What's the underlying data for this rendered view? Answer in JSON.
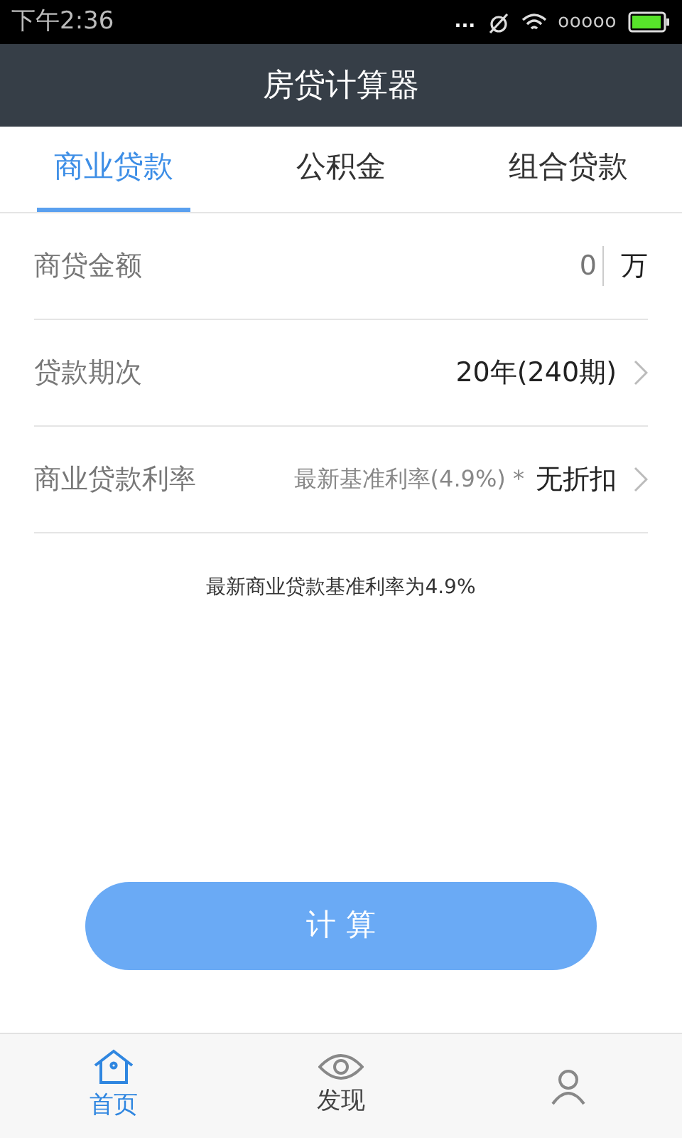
{
  "status_bar": {
    "time": "下午2:36",
    "dots": "...",
    "carrier": "ooooo"
  },
  "title": "房贷计算器",
  "tabs": [
    {
      "label": "商业贷款",
      "selected": true
    },
    {
      "label": "公积金",
      "selected": false
    },
    {
      "label": "组合贷款",
      "selected": false
    }
  ],
  "rows": [
    {
      "kind": "input",
      "label": "商贷金额",
      "value": "0",
      "unit": "万"
    },
    {
      "kind": "select",
      "label": "贷款期次",
      "value": "20年(240期)"
    },
    {
      "kind": "select",
      "label": "商业贷款利率",
      "hint": "最新基准利率(4.9%) *",
      "value": "无折扣"
    }
  ],
  "note": "最新商业贷款基准利率为4.9%",
  "button": "计 算",
  "bottom_nav": [
    {
      "kind": "home",
      "label": "首页",
      "selected": true
    },
    {
      "kind": "eye",
      "label": "发现",
      "selected": false
    },
    {
      "kind": "person",
      "selected": false
    }
  ]
}
